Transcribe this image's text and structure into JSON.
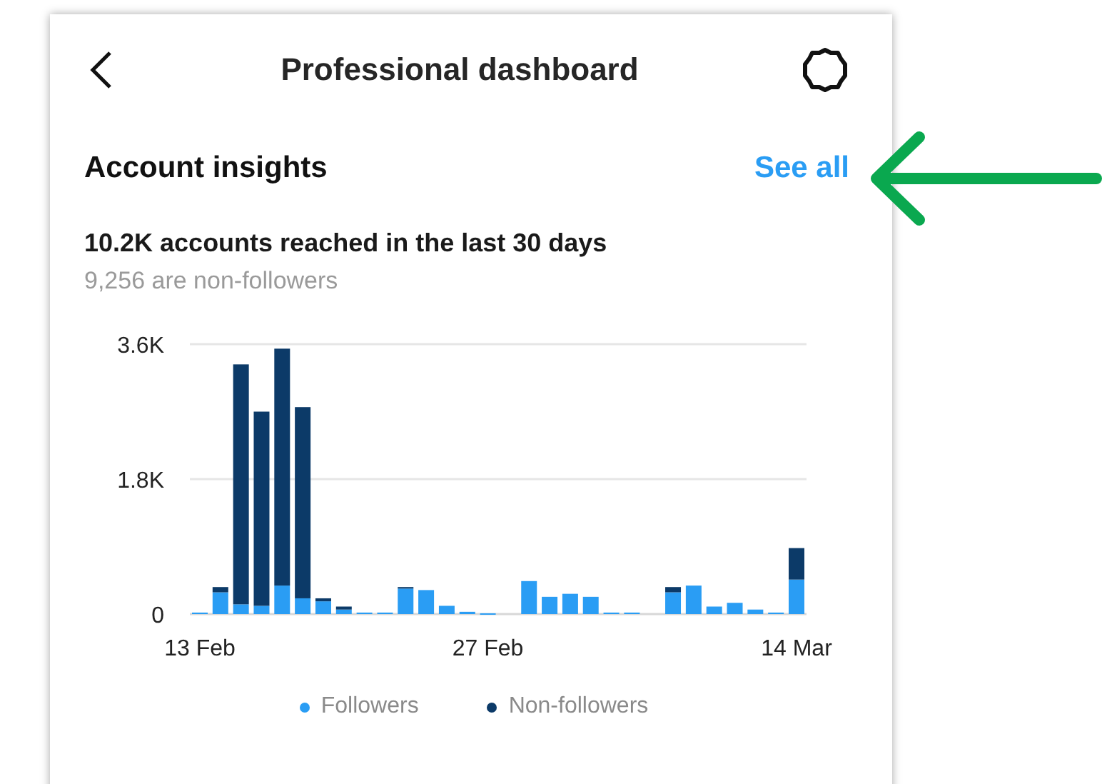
{
  "header": {
    "title": "Professional dashboard"
  },
  "insights": {
    "title": "Account insights",
    "link": "See all",
    "summary": "10.2K accounts reached in the last 30 days",
    "subtitle": "9,256 are non-followers",
    "chart_data": {
      "type": "bar",
      "stacked": true,
      "categories": [
        "13 Feb",
        null,
        null,
        null,
        null,
        null,
        null,
        null,
        null,
        null,
        null,
        null,
        null,
        null,
        "27 Feb",
        null,
        null,
        null,
        null,
        null,
        null,
        null,
        null,
        null,
        null,
        null,
        null,
        null,
        null,
        "14 Mar"
      ],
      "series": [
        {
          "name": "Followers",
          "color": "#2a9df4",
          "values": [
            20,
            290,
            130,
            110,
            380,
            210,
            170,
            60,
            20,
            20,
            340,
            320,
            110,
            30,
            10,
            0,
            440,
            230,
            270,
            230,
            20,
            20,
            0,
            290,
            380,
            100,
            150,
            60,
            20,
            460
          ]
        },
        {
          "name": "Non-followers",
          "color": "#0c3a68",
          "values": [
            0,
            70,
            3200,
            2590,
            3160,
            2550,
            40,
            40,
            0,
            0,
            20,
            0,
            0,
            0,
            0,
            0,
            0,
            0,
            0,
            0,
            0,
            0,
            0,
            70,
            0,
            0,
            0,
            0,
            0,
            420
          ]
        }
      ],
      "ylim": [
        0,
        3600
      ],
      "yticks": [
        0,
        {
          "value": 1800,
          "label": "1.8K"
        },
        {
          "value": 3600,
          "label": "3.6K"
        }
      ]
    }
  }
}
